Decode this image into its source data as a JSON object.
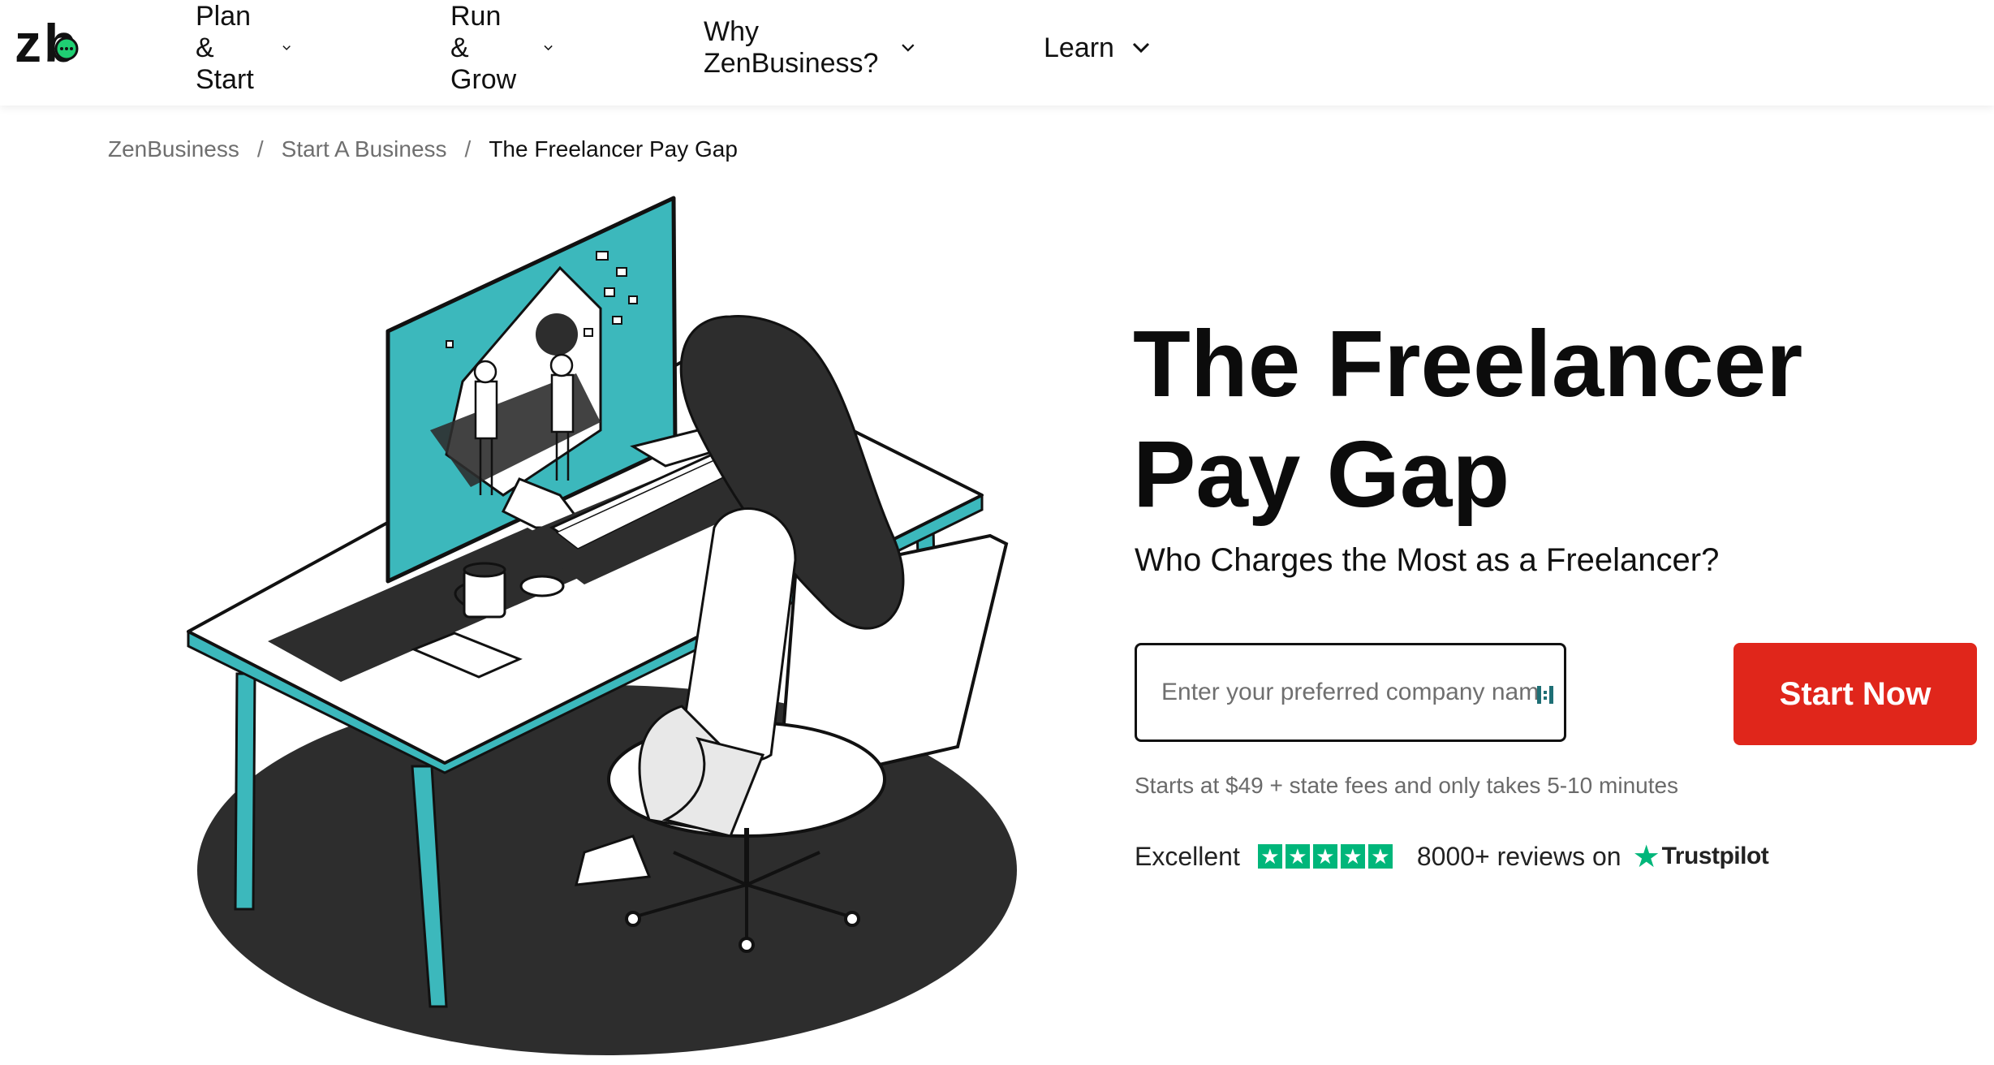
{
  "brand": {
    "logo_text": "zb",
    "accent": "#1fcf72"
  },
  "nav": {
    "items": [
      {
        "label": "Plan & Start"
      },
      {
        "label": "Run & Grow"
      },
      {
        "label": "Why ZenBusiness?"
      },
      {
        "label": "Learn"
      }
    ]
  },
  "breadcrumb": {
    "items": [
      "ZenBusiness",
      "Start A Business"
    ],
    "separator": "/",
    "current": "The Freelancer Pay Gap"
  },
  "hero": {
    "title_line1": "The Freelancer",
    "title_line2": "Pay Gap",
    "subtitle": "Who Charges the Most as a Freelancer?",
    "input_placeholder": "Enter your preferred company name",
    "cta_label": "Start Now",
    "cta_color": "#e0261b",
    "fine_print": "Starts at $49 + state fees and only takes 5-10 minutes"
  },
  "rating": {
    "label": "Excellent",
    "stars": 5,
    "reviews_text": "8000+ reviews on",
    "provider": "Trustpilot",
    "star_color": "#00b67a"
  },
  "illustration": {
    "teal": "#3cb8bc",
    "dark": "#2d2d2d"
  }
}
